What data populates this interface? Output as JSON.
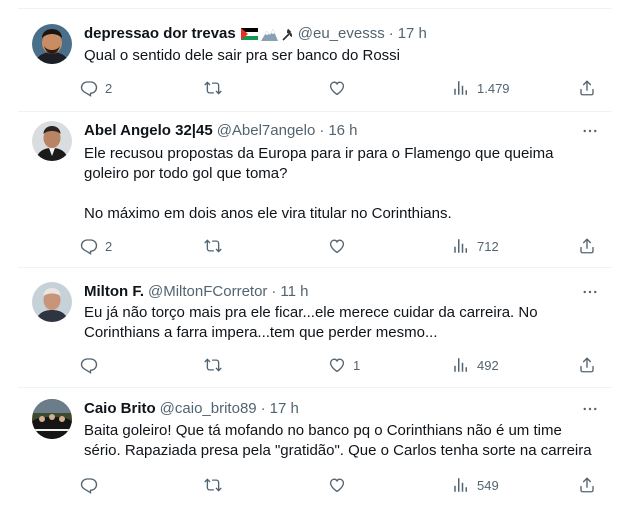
{
  "colors": {
    "text": "#0f1419",
    "secondary": "#536471",
    "divider": "#eff3f4",
    "background": "#ffffff"
  },
  "tweets": [
    {
      "name": "depressao dor trevas",
      "handle": "@eu_evesss",
      "separator": "·",
      "time": "17 h",
      "flag_icons": [
        "palestine-flag-icon",
        "mountain-icon",
        "hammer-sickle-icon"
      ],
      "lines": [
        "Qual o sentido dele sair pra ser banco do Rossi"
      ],
      "reply_count": "2",
      "retweet_count": "",
      "like_count": "",
      "view_count": "1.479"
    },
    {
      "name": "Abel Angelo 32|45",
      "handle": "@Abel7angelo",
      "separator": "·",
      "time": "16 h",
      "lines": [
        "Ele recusou propostas da Europa para ir para o Flamengo que queima",
        "goleiro por todo gol que toma?"
      ],
      "lines2": [
        "No máximo em dois anos ele vira titular no Corinthians."
      ],
      "reply_count": "2",
      "retweet_count": "",
      "like_count": "",
      "view_count": "712"
    },
    {
      "name": "Milton F.",
      "handle": "@MiltonFCorretor",
      "separator": "·",
      "time": "11 h",
      "lines": [
        "Eu já não torço mais pra ele ficar...ele merece cuidar da carreira. No",
        "Corinthians a farra impera...tem que perder mesmo..."
      ],
      "reply_count": "",
      "retweet_count": "",
      "like_count": "1",
      "view_count": "492"
    },
    {
      "name": "Caio Brito",
      "handle": "@caio_brito89",
      "separator": "·",
      "time": "17 h",
      "lines": [
        "Baita goleiro! Que tá mofando no banco pq o Corinthians não é um time",
        "sério. Rapaziada presa pela \"gratidão\". Que o Carlos tenha sorte na carreira"
      ],
      "reply_count": "",
      "retweet_count": "",
      "like_count": "",
      "view_count": "549"
    }
  ]
}
